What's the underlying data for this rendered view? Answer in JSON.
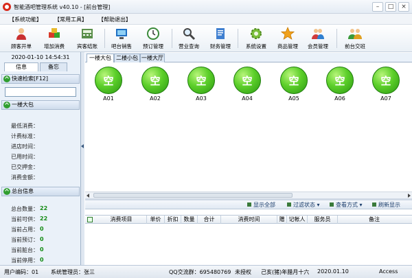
{
  "window": {
    "title": "智能酒吧管理系统 v40.10 - [前台管理]",
    "controls": [
      "minimize",
      "maximize",
      "close"
    ]
  },
  "menu": [
    "【系统功能】",
    "【常用工具】",
    "【帮助退出】"
  ],
  "toolbar": [
    {
      "label": "顾客开单",
      "icon": "customer-icon"
    },
    {
      "label": "增加消费",
      "icon": "add-consumption-icon"
    },
    {
      "label": "宾客结账",
      "icon": "checkout-icon"
    },
    {
      "label": "吧台销售",
      "icon": "bar-sales-icon"
    },
    {
      "label": "预订管理",
      "icon": "reservation-icon"
    },
    {
      "label": "营业查询",
      "icon": "search-icon"
    },
    {
      "label": "财务管理",
      "icon": "finance-icon"
    },
    {
      "label": "系统设置",
      "icon": "gear-icon"
    },
    {
      "label": "商品管理",
      "icon": "star-icon"
    },
    {
      "label": "会员管理",
      "icon": "members-icon"
    },
    {
      "label": "前台交班",
      "icon": "handover-icon"
    }
  ],
  "left": {
    "datetime": "2020-01-10 14:54:31",
    "tabs": [
      "信息",
      "备忘"
    ],
    "quick_search": "快速检索[F12]",
    "search_value": "",
    "area_header": "一楼大包",
    "fields": [
      "最低消费：",
      "计费标准：",
      "进店时间：",
      "已用时间：",
      "已交押金：",
      "消费金额："
    ],
    "total_header": "总台信息",
    "stats": [
      {
        "label": "总台数量：",
        "value": "22"
      },
      {
        "label": "当前可供：",
        "value": "22"
      },
      {
        "label": "当前占用：",
        "value": "0"
      },
      {
        "label": "当前预订：",
        "value": "0"
      },
      {
        "label": "当前脏台：",
        "value": "0"
      },
      {
        "label": "当前停用：",
        "value": "0"
      }
    ]
  },
  "area_tabs": [
    "一楼大包",
    "二楼小包",
    "一楼大厅"
  ],
  "tables": [
    {
      "name": "A01",
      "status": "空"
    },
    {
      "name": "A02",
      "status": "空"
    },
    {
      "name": "A03",
      "status": "空"
    },
    {
      "name": "A04",
      "status": "空"
    },
    {
      "name": "A05",
      "status": "空"
    },
    {
      "name": "A06",
      "status": "空"
    },
    {
      "name": "A07",
      "status": "空"
    }
  ],
  "filters": [
    "显示全部",
    "过滤状态",
    "查看方式",
    "刷新显示"
  ],
  "grid_columns": [
    "消费项目",
    "单价",
    "折扣",
    "数量",
    "合计",
    "消费时间",
    "赠",
    "记帐人",
    "服务员",
    "备注"
  ],
  "status": {
    "user_code": "用户编码：01",
    "system_admin": "系统管理员：张三",
    "qq": "QQ交流群：695480769",
    "license": "未授权",
    "lunar": "己亥(猪)年腊月十六",
    "date": "2020.01.10",
    "db": "Access"
  },
  "colors": {
    "accent_green": "#2c9a12",
    "panel_blue": "#eaf1f9"
  }
}
